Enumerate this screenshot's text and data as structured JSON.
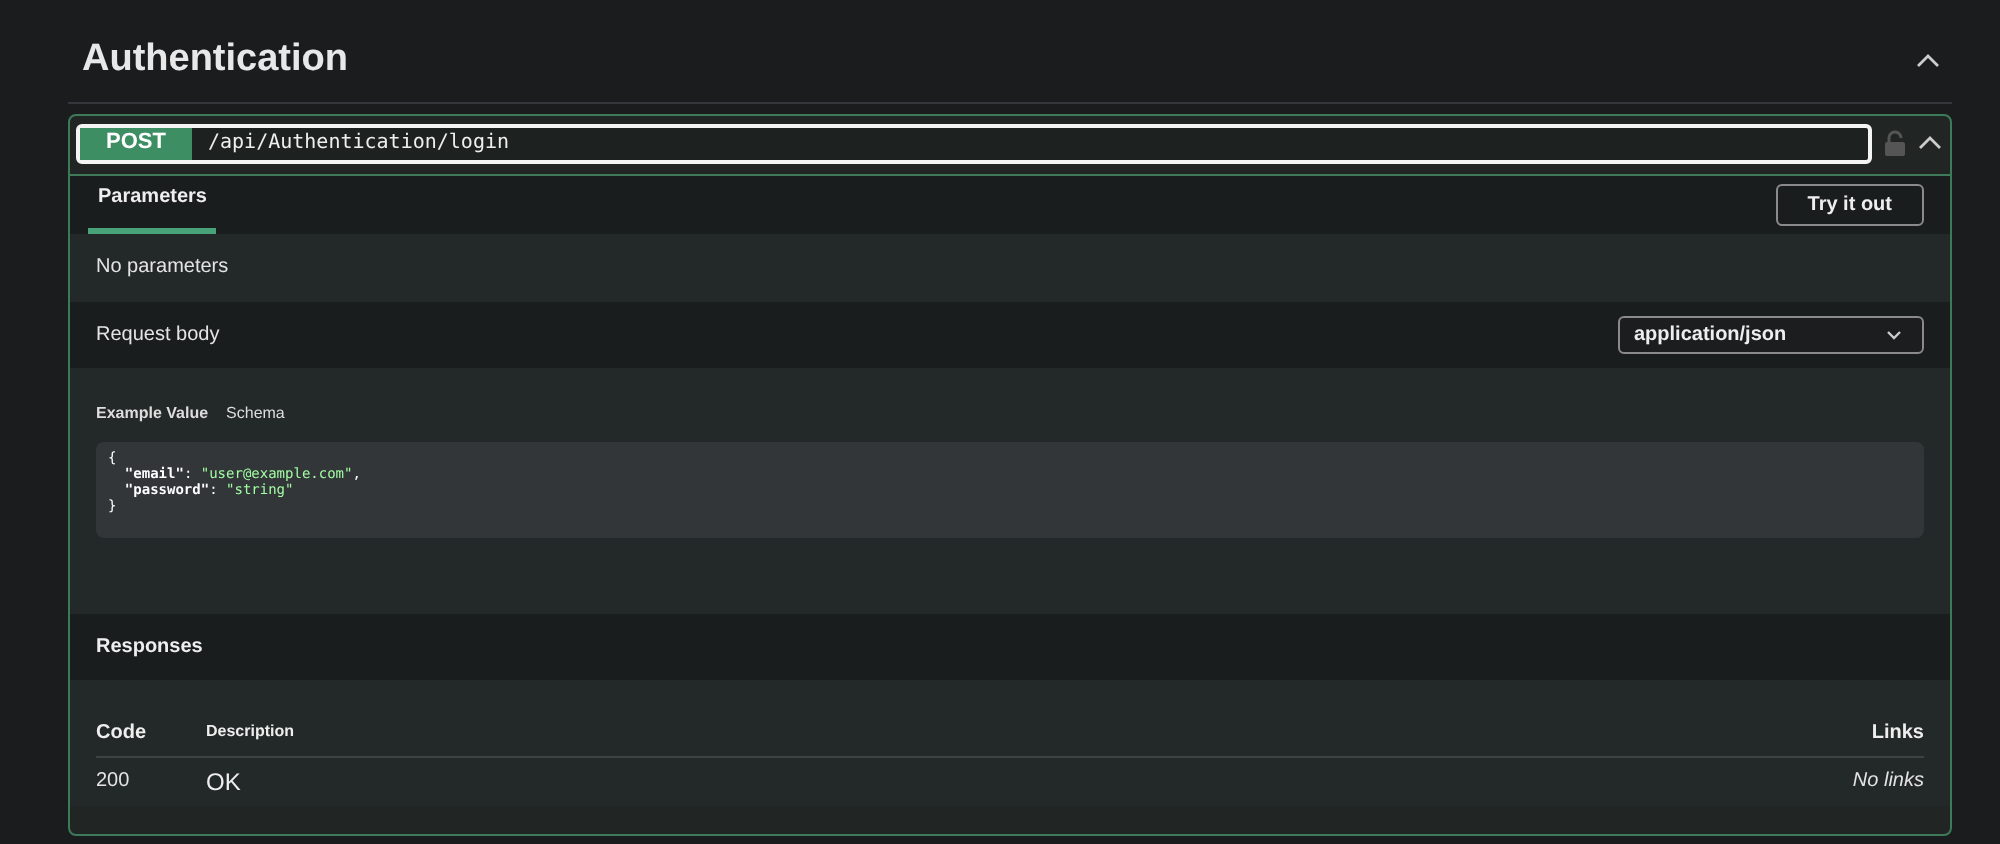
{
  "section": {
    "title": "Authentication",
    "expanded": true
  },
  "operation": {
    "method": "POST",
    "path": "/api/Authentication/login",
    "locked": false,
    "expanded": true
  },
  "tabs": [
    {
      "label": "Parameters",
      "selected": true
    }
  ],
  "try_button": "Try it out",
  "parameters_text": "No parameters",
  "request_body": {
    "label": "Request body",
    "content_type": "application/json"
  },
  "example_tabs": [
    {
      "label": "Example Value",
      "selected": true
    },
    {
      "label": "Schema",
      "selected": false
    }
  ],
  "example_lines": [
    [
      {
        "text": "{",
        "kind": "punct"
      }
    ],
    [
      {
        "text": "  \"email\"",
        "kind": "key"
      },
      {
        "text": ": ",
        "kind": "punct"
      },
      {
        "text": "\"user@example.com\"",
        "kind": "string"
      },
      {
        "text": ",",
        "kind": "punct"
      }
    ],
    [
      {
        "text": "  \"password\"",
        "kind": "key"
      },
      {
        "text": ": ",
        "kind": "punct"
      },
      {
        "text": "\"string\"",
        "kind": "string"
      }
    ],
    [
      {
        "text": "}",
        "kind": "punct"
      }
    ]
  ],
  "responses": {
    "title": "Responses",
    "columns": [
      "Code",
      "Description",
      "Links"
    ],
    "rows": [
      {
        "code": "200",
        "description": "OK",
        "links": "No links"
      }
    ]
  }
}
